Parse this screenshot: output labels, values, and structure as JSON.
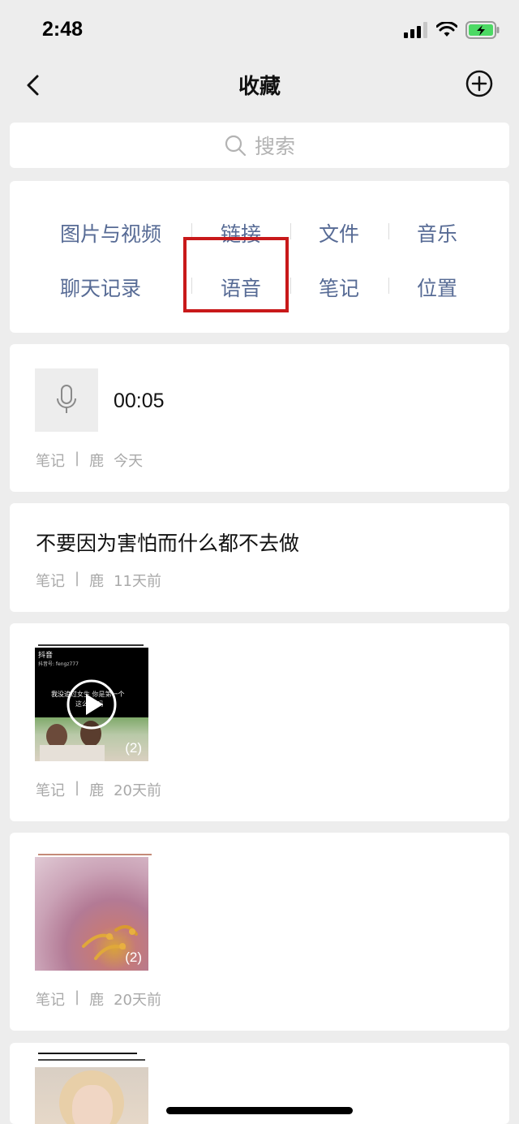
{
  "status": {
    "time": "2:48"
  },
  "nav": {
    "title": "收藏"
  },
  "search": {
    "placeholder": "搜索"
  },
  "categories": {
    "row1": [
      "图片与视频",
      "链接",
      "文件",
      "音乐"
    ],
    "row2": [
      "聊天记录",
      "语音",
      "笔记",
      "位置"
    ],
    "highlighted": "语音"
  },
  "items": [
    {
      "type": "voice",
      "duration": "00:05",
      "source": "笔记",
      "separator": "|",
      "author": "鹿",
      "time": "今天"
    },
    {
      "type": "text",
      "content": "不要因为害怕而什么都不去做",
      "source": "笔记",
      "separator": "|",
      "author": "鹿",
      "time": "11天前"
    },
    {
      "type": "video",
      "count": "(2)",
      "overlay_app": "抖音",
      "overlay_id": "抖音号: fengz777",
      "overlay_caption_1": "我没追过女生 你是第一个",
      "overlay_caption_2": "这么… 吗",
      "source": "笔记",
      "separator": "|",
      "author": "鹿",
      "time": "20天前"
    },
    {
      "type": "image",
      "count": "(2)",
      "source": "笔记",
      "separator": "|",
      "author": "鹿",
      "time": "20天前"
    },
    {
      "type": "image"
    }
  ],
  "colors": {
    "link": "#576b95",
    "highlight": "#c8191a",
    "meta": "#a9a9a9",
    "battery": "#4cd964"
  },
  "icons": [
    "signal-icon",
    "wifi-icon",
    "battery-icon",
    "back-chevron-icon",
    "add-circle-icon",
    "search-icon",
    "microphone-icon",
    "play-icon"
  ]
}
